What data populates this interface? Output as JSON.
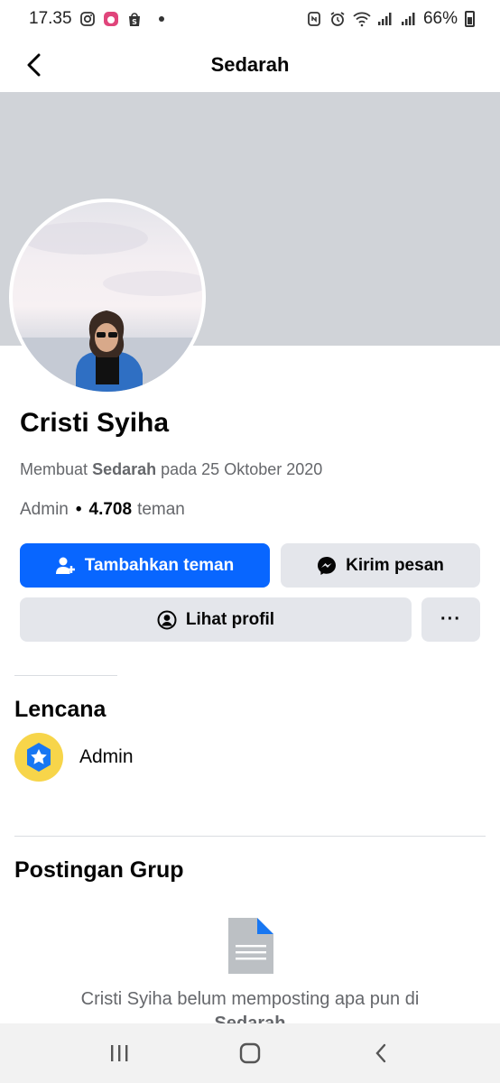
{
  "status_bar": {
    "time": "17.35",
    "battery": "66%",
    "icons": [
      "instagram-icon",
      "app-icon",
      "shopee-icon",
      "notification-dot",
      "nfc-icon",
      "alarm-icon",
      "wifi-icon",
      "signal-icon",
      "signal-icon",
      "battery-icon"
    ]
  },
  "header": {
    "title": "Sedarah",
    "back_icon": "back-arrow-icon"
  },
  "profile": {
    "name": "Cristi Syiha",
    "created_prefix": "Membuat",
    "created_group": "Sedarah",
    "created_suffix": "pada 25 Oktober 2020",
    "role": "Admin",
    "friend_count": "4.708",
    "friend_label": "teman"
  },
  "actions": {
    "add_friend": "Tambahkan teman",
    "message": "Kirim pesan",
    "view_profile": "Lihat profil",
    "more": "···"
  },
  "badges": {
    "title": "Lencana",
    "items": [
      {
        "label": "Admin",
        "icon": "admin-star-badge-icon"
      }
    ]
  },
  "posts": {
    "title": "Postingan Grup",
    "empty_line1": "Cristi Syiha belum memposting apa pun di",
    "empty_line2": "Sedarah"
  },
  "colors": {
    "primary": "#0866ff",
    "secondary_button": "#e4e6eb",
    "cover": "#d0d3d8",
    "badge": "#f7d54a",
    "muted_text": "#65676b"
  },
  "nav": {
    "items": [
      "recent-apps-icon",
      "home-icon",
      "back-icon"
    ]
  }
}
